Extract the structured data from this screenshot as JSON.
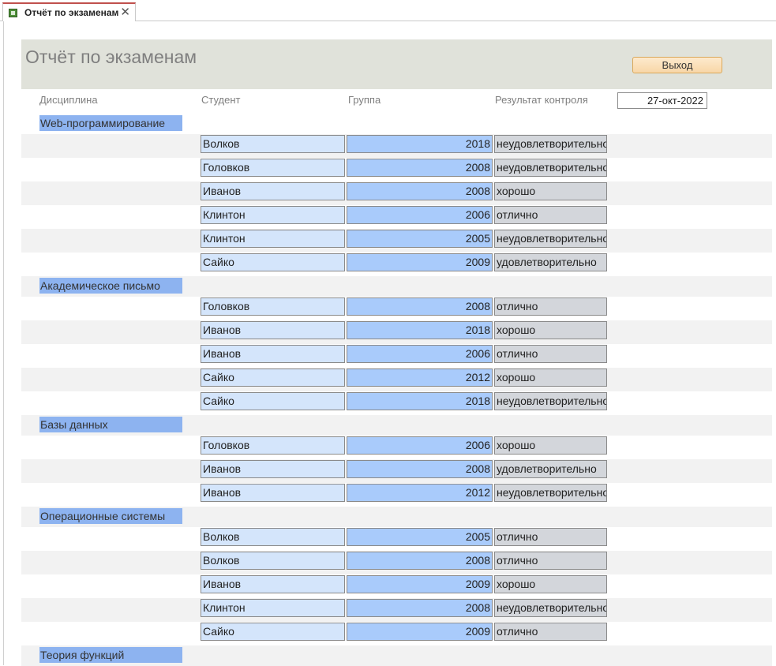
{
  "tab": {
    "title": "Отчёт по экзаменам",
    "close": "✕"
  },
  "report": {
    "title": "Отчёт по экзаменам",
    "exit_label": "Выход",
    "date": "27-окт-2022"
  },
  "columns": {
    "discipline": "Дисциплина",
    "student": "Студент",
    "group": "Группа",
    "result": "Результат контроля"
  },
  "groups": [
    {
      "discipline": "Web-программирование",
      "rows": [
        {
          "student": "Волков",
          "group": "2018",
          "result": "неудовлетворительно"
        },
        {
          "student": "Головков",
          "group": "2008",
          "result": "неудовлетворительно"
        },
        {
          "student": "Иванов",
          "group": "2008",
          "result": "хорошо"
        },
        {
          "student": "Клинтон",
          "group": "2006",
          "result": "отлично"
        },
        {
          "student": "Клинтон",
          "group": "2005",
          "result": "неудовлетворительно"
        },
        {
          "student": "Сайко",
          "group": "2009",
          "result": "удовлетворительно"
        }
      ]
    },
    {
      "discipline": "Академическое письмо",
      "rows": [
        {
          "student": "Головков",
          "group": "2008",
          "result": "отлично"
        },
        {
          "student": "Иванов",
          "group": "2018",
          "result": "хорошо"
        },
        {
          "student": "Иванов",
          "group": "2006",
          "result": "отлично"
        },
        {
          "student": "Сайко",
          "group": "2012",
          "result": "хорошо"
        },
        {
          "student": "Сайко",
          "group": "2018",
          "result": "неудовлетворительно"
        }
      ]
    },
    {
      "discipline": "Базы данных",
      "rows": [
        {
          "student": "Головков",
          "group": "2006",
          "result": "хорошо"
        },
        {
          "student": "Иванов",
          "group": "2008",
          "result": "удовлетворительно"
        },
        {
          "student": "Иванов",
          "group": "2012",
          "result": "неудовлетворительно"
        }
      ]
    },
    {
      "discipline": "Операционные системы",
      "rows": [
        {
          "student": "Волков",
          "group": "2005",
          "result": "отлично"
        },
        {
          "student": "Волков",
          "group": "2008",
          "result": "отлично"
        },
        {
          "student": "Иванов",
          "group": "2009",
          "result": "хорошо"
        },
        {
          "student": "Клинтон",
          "group": "2008",
          "result": "неудовлетворительно"
        },
        {
          "student": "Сайко",
          "group": "2009",
          "result": "отлично"
        }
      ]
    },
    {
      "discipline": "Теория функций",
      "rows": []
    }
  ]
}
